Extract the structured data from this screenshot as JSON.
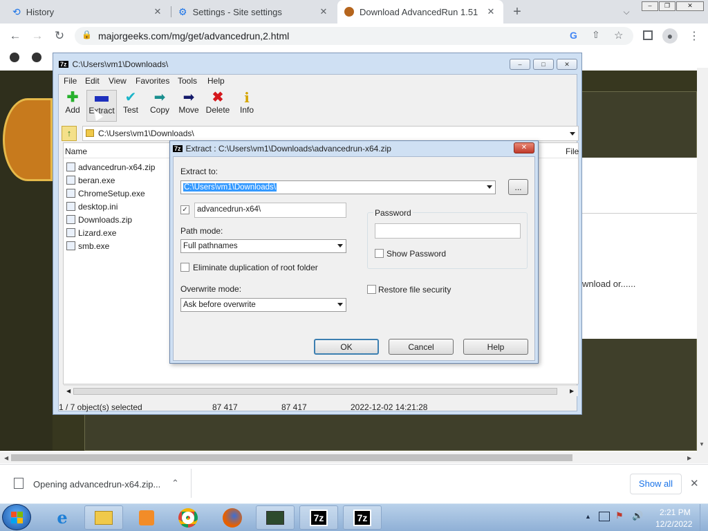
{
  "browser": {
    "tabs": [
      {
        "label": "History",
        "icon": "history-icon"
      },
      {
        "label": "Settings - Site settings",
        "icon": "gear-icon"
      },
      {
        "label": "Download AdvancedRun 1.51",
        "icon": "majorgeeks-favicon",
        "active": true
      }
    ],
    "url": "majorgeeks.com/mg/get/advancedrun,2.html",
    "page_text": "wnload or......"
  },
  "downloads": {
    "item": "Opening advancedrun-x64.zip...",
    "show_all": "Show all"
  },
  "fm": {
    "title": "C:\\Users\\vm1\\Downloads\\",
    "menu": [
      "File",
      "Edit",
      "View",
      "Favorites",
      "Tools",
      "Help"
    ],
    "tools": [
      {
        "label": "Add",
        "icon": "plus-icon"
      },
      {
        "label": "Extract",
        "icon": "minus-icon"
      },
      {
        "label": "Test",
        "icon": "check-icon"
      },
      {
        "label": "Copy",
        "icon": "arrow-right-icon"
      },
      {
        "label": "Move",
        "icon": "arrow-right-bold-icon"
      },
      {
        "label": "Delete",
        "icon": "x-icon"
      },
      {
        "label": "Info",
        "icon": "info-icon"
      }
    ],
    "address": "C:\\Users\\vm1\\Downloads\\",
    "col_name": "Name",
    "col_file": "File",
    "files": [
      "advancedrun-x64.zip",
      "beran.exe",
      "ChromeSetup.exe",
      "desktop.ini",
      "Downloads.zip",
      "Lizard.exe",
      "smb.exe"
    ],
    "status": {
      "selected": "1 / 7 object(s) selected",
      "size": "87 417",
      "packed": "87 417",
      "modified": "2022-12-02 14:21:28"
    }
  },
  "dialog": {
    "title": "Extract : C:\\Users\\vm1\\Downloads\\advancedrun-x64.zip",
    "extract_to_label": "Extract to:",
    "extract_to_value": "C:\\Users\\vm1\\Downloads\\",
    "browse": "...",
    "subfolder": "advancedrun-x64\\",
    "path_mode_label": "Path mode:",
    "path_mode_value": "Full pathnames",
    "eliminate_label": "Eliminate duplication of root folder",
    "overwrite_label": "Overwrite mode:",
    "overwrite_value": "Ask before overwrite",
    "password_label": "Password",
    "show_password": "Show Password",
    "restore_security": "Restore file security",
    "ok": "OK",
    "cancel": "Cancel",
    "help": "Help"
  },
  "taskbar": {
    "time": "2:21 PM",
    "date": "12/2/2022",
    "apps": [
      "ie-icon",
      "explorer-icon",
      "media-player-icon",
      "chrome-icon",
      "firefox-icon",
      "cmd-icon",
      "7zip-icon",
      "7zip-icon"
    ]
  },
  "colors": {
    "selection": "#3399ff",
    "delete": "#d4171c",
    "add": "#27b12d",
    "extract": "#1d2fbd"
  }
}
